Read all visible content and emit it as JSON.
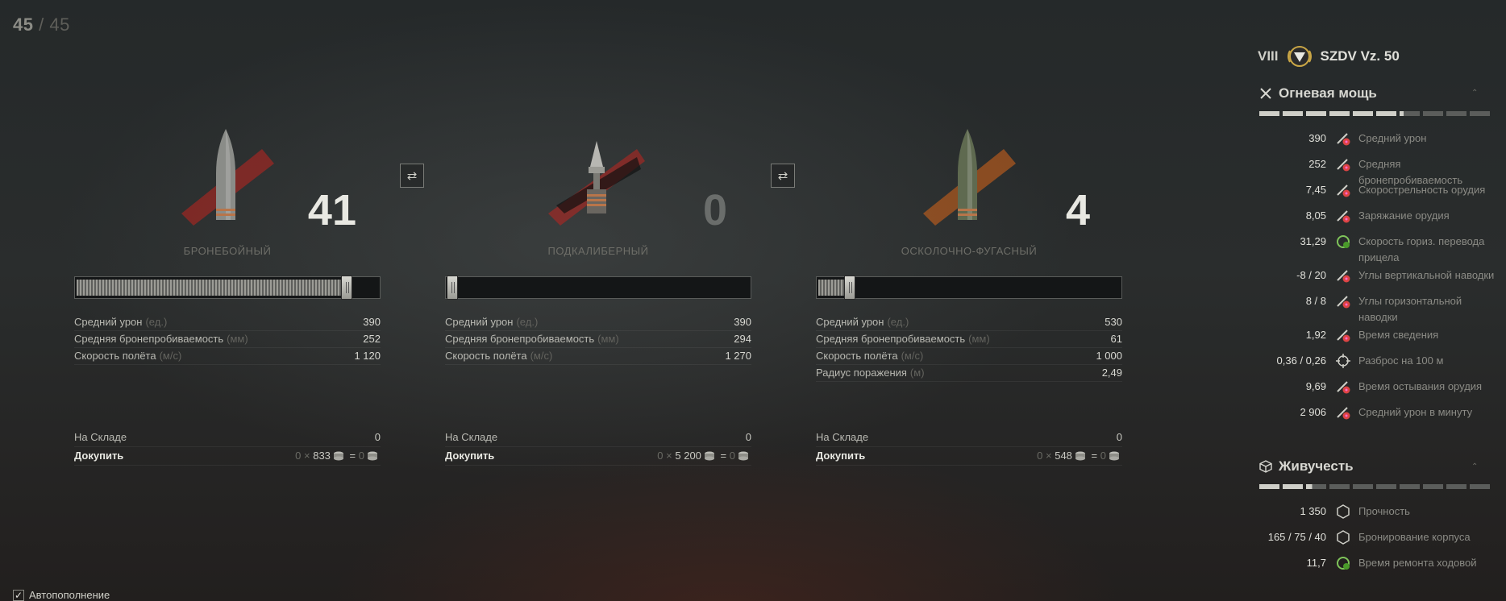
{
  "counter": {
    "current": "45",
    "sep": "/",
    "max": "45"
  },
  "shells": [
    {
      "name": "БРОНЕБОЙНЫЙ",
      "count": "41",
      "slider_fraction": 0.91,
      "stats": [
        {
          "label": "Средний урон",
          "unit": "(ед.)",
          "value": "390"
        },
        {
          "label": "Средняя бронепробиваемость",
          "unit": "(мм)",
          "value": "252"
        },
        {
          "label": "Скорость полёта",
          "unit": "(м/с)",
          "value": "1 120"
        }
      ],
      "stock_label": "На Складе",
      "stock_value": "0",
      "buy_label": "Докупить",
      "buy_qty": "0",
      "buy_times": "×",
      "buy_price": "833",
      "buy_eq": "=",
      "buy_total": "0"
    },
    {
      "name": "ПОДКАЛИБЕРНЫЙ",
      "count": "0",
      "slider_fraction": 0.0,
      "stats": [
        {
          "label": "Средний урон",
          "unit": "(ед.)",
          "value": "390"
        },
        {
          "label": "Средняя бронепробиваемость",
          "unit": "(мм)",
          "value": "294"
        },
        {
          "label": "Скорость полёта",
          "unit": "(м/с)",
          "value": "1 270"
        }
      ],
      "stock_label": "На Складе",
      "stock_value": "0",
      "buy_label": "Докупить",
      "buy_qty": "0",
      "buy_times": "×",
      "buy_price": "5 200",
      "buy_eq": "=",
      "buy_total": "0"
    },
    {
      "name": "ОСКОЛОЧНО-ФУГАСНЫЙ",
      "count": "4",
      "slider_fraction": 0.09,
      "stats": [
        {
          "label": "Средний урон",
          "unit": "(ед.)",
          "value": "530"
        },
        {
          "label": "Средняя бронепробиваемость",
          "unit": "(мм)",
          "value": "61"
        },
        {
          "label": "Скорость полёта",
          "unit": "(м/с)",
          "value": "1 000"
        },
        {
          "label": "Радиус поражения",
          "unit": "(м)",
          "value": "2,49"
        }
      ],
      "stock_label": "На Складе",
      "stock_value": "0",
      "buy_label": "Докупить",
      "buy_qty": "0",
      "buy_times": "×",
      "buy_price": "548",
      "buy_eq": "=",
      "buy_total": "0"
    }
  ],
  "swap_icon": "⇄",
  "autofill": {
    "label": "Автопополнение",
    "checked": true
  },
  "tank": {
    "tier": "VIII",
    "name": "SZDV Vz. 50"
  },
  "firepower": {
    "title": "Огневая мощь",
    "segments_total": 10,
    "segments_on": 6.2,
    "stats": [
      {
        "value": "390",
        "label": "Средний урон",
        "icon": "damage-icon"
      },
      {
        "value": "252",
        "label": "Средняя бронепробиваемость",
        "icon": "penetration-icon"
      },
      {
        "value": "7,45",
        "label": "Скорострельность орудия",
        "icon": "rate-of-fire-icon"
      },
      {
        "value": "8,05",
        "label": "Заряжание орудия",
        "icon": "reload-icon"
      },
      {
        "value": "31,29",
        "label": "Скорость гориз. перевода прицела",
        "icon": "traverse-icon"
      },
      {
        "value": "-8 / 20",
        "label": "Углы вертикальной наводки",
        "icon": "vertical-angles-icon"
      },
      {
        "value": "8 / 8",
        "label": "Углы горизонтальной наводки",
        "icon": "horizontal-angles-icon"
      },
      {
        "value": "1,92",
        "label": "Время сведения",
        "icon": "aim-time-icon"
      },
      {
        "value": "0,36 / 0,26",
        "label": "Разброс на 100 м",
        "icon": "dispersion-icon"
      },
      {
        "value": "9,69",
        "label": "Время остывания орудия",
        "icon": "cooldown-icon"
      },
      {
        "value": "2 906",
        "label": "Средний урон в минуту",
        "icon": "dpm-icon"
      }
    ]
  },
  "survivability": {
    "title": "Живучесть",
    "segments_total": 10,
    "segments_on": 2.3,
    "stats": [
      {
        "value": "1 350",
        "label": "Прочность",
        "icon": "hitpoints-icon"
      },
      {
        "value": "165 / 75 / 40",
        "label": "Бронирование корпуса",
        "icon": "hull-armor-icon"
      },
      {
        "value": "11,7",
        "label": "Время ремонта ходовой",
        "icon": "repair-icon"
      }
    ]
  },
  "colors": {
    "accent_red": "#c0241f",
    "accent_orange": "#d8661a",
    "text": "#e0e0da"
  }
}
